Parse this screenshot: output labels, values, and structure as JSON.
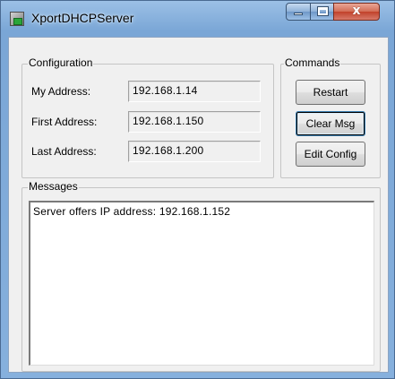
{
  "window": {
    "title": "XportDHCPServer",
    "close_glyph": "x"
  },
  "configuration": {
    "group_label": "Configuration",
    "my_address_label": "My Address:",
    "my_address_value": "192.168.1.14",
    "first_address_label": "First Address:",
    "first_address_value": "192.168.1.150",
    "last_address_label": "Last Address:",
    "last_address_value": "192.168.1.200"
  },
  "commands": {
    "group_label": "Commands",
    "restart_label": "Restart",
    "clear_msg_label": "Clear Msg",
    "edit_config_label": "Edit Config"
  },
  "messages": {
    "group_label": "Messages",
    "lines": [
      "Server offers IP address: 192.168.1.152"
    ]
  },
  "icons": {
    "app": "app-icon",
    "minimize": "minimize-icon",
    "maximize": "maximize-icon",
    "close": "close-icon"
  }
}
